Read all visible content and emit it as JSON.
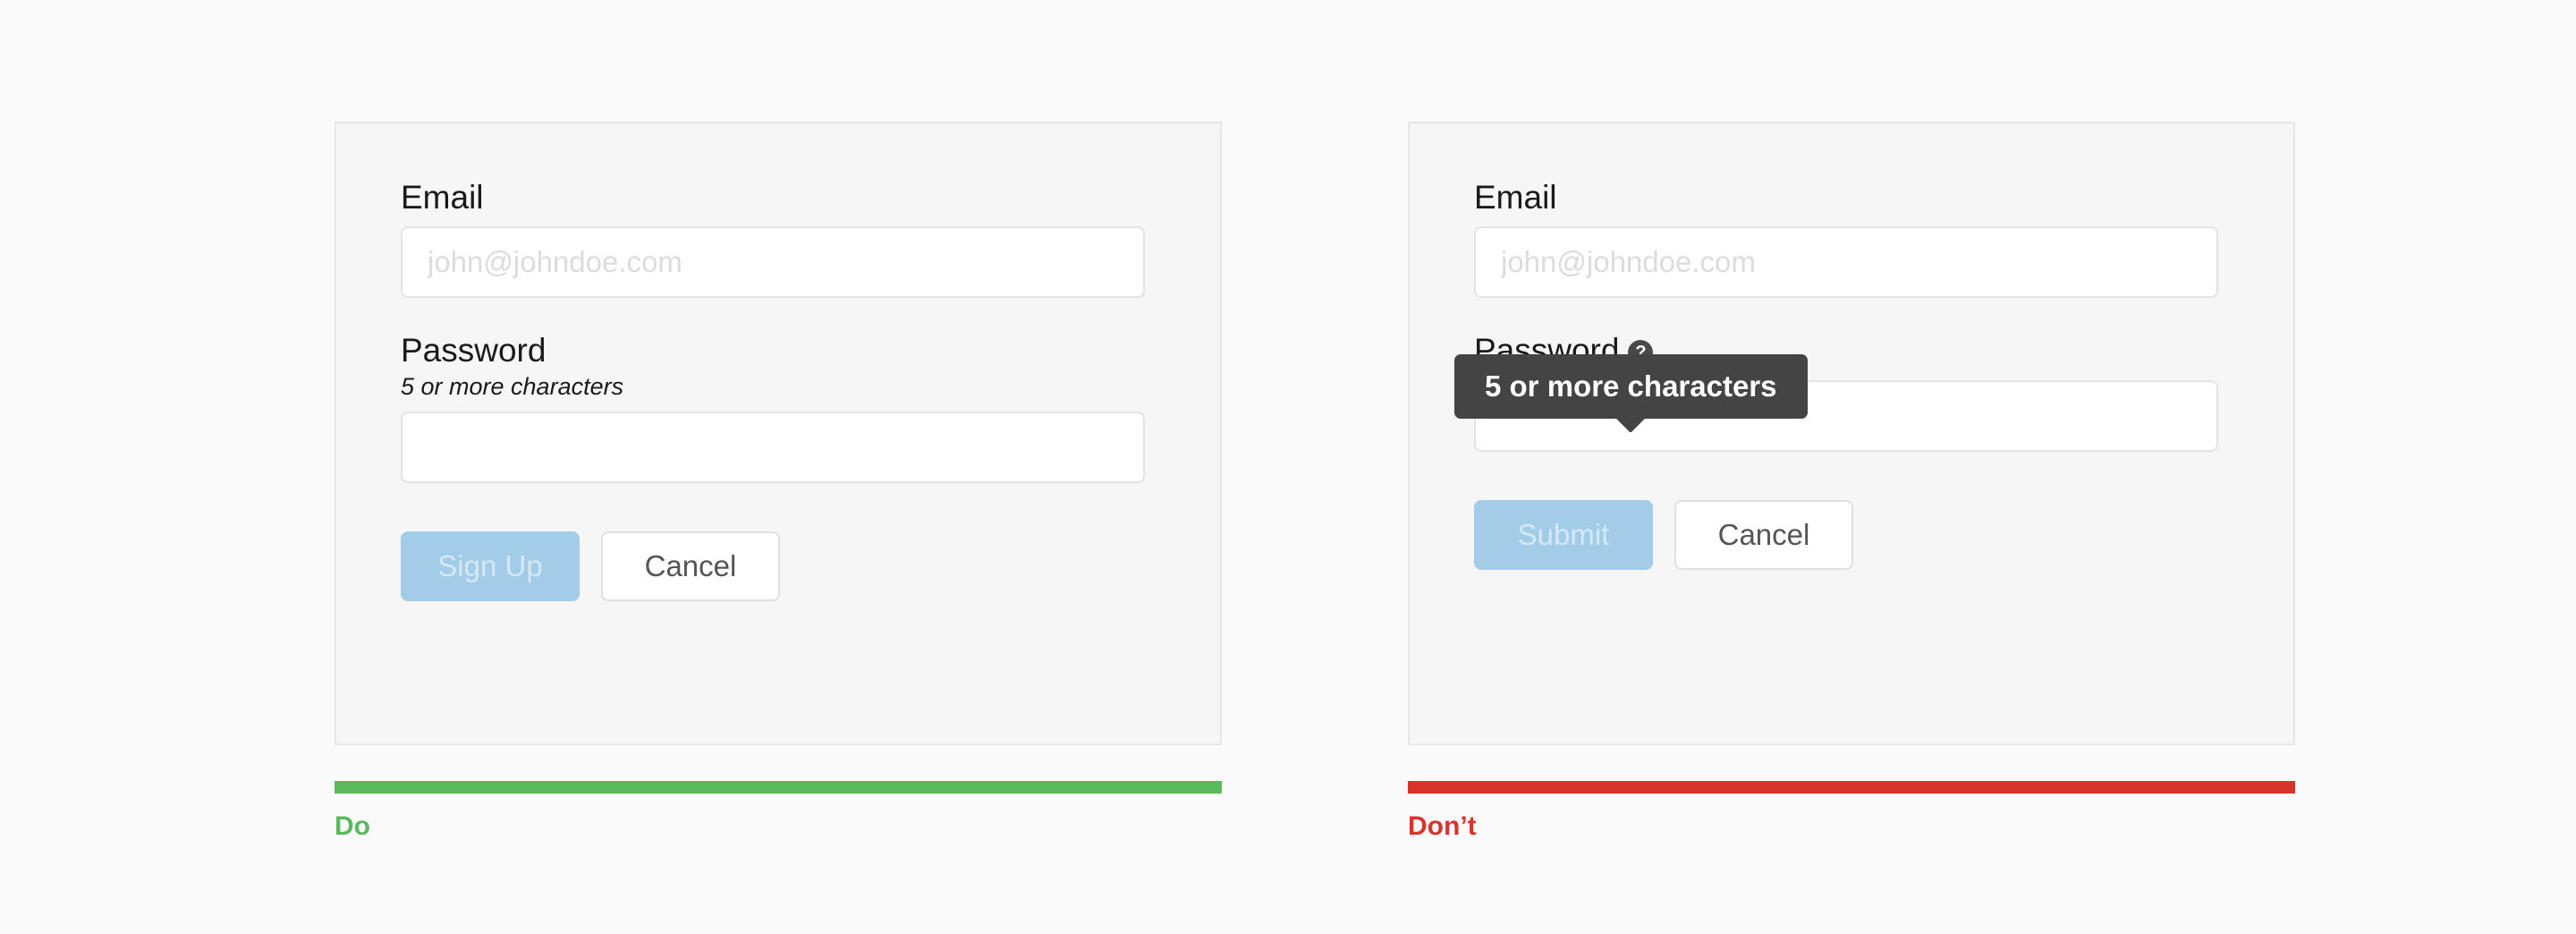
{
  "page": {
    "background_color": "#fafafa"
  },
  "examples": [
    {
      "variant": "do",
      "verdict_label": "Do",
      "verdict_color": "#5cb85c",
      "bar_color": "#5cb85c",
      "fields": {
        "email": {
          "label": "Email",
          "placeholder": "john@johndoe.com",
          "value": ""
        },
        "password": {
          "label": "Password",
          "helper_text": "5 or more characters",
          "placeholder": "",
          "value": ""
        }
      },
      "buttons": {
        "primary": "Sign Up",
        "secondary": "Cancel"
      },
      "tooltip": null
    },
    {
      "variant": "dont",
      "verdict_label": "Don’t",
      "verdict_color": "#d9342b",
      "bar_color": "#d9342b",
      "fields": {
        "email": {
          "label": "Email",
          "placeholder": "john@johndoe.com",
          "value": ""
        },
        "password": {
          "label": "Password",
          "helper_icon": "question-mark-help-icon",
          "helper_icon_glyph": "?",
          "placeholder": "",
          "value": ""
        }
      },
      "buttons": {
        "primary": "Submit",
        "secondary": "Cancel"
      },
      "tooltip": {
        "text": "5 or more characters",
        "background_color": "#444444",
        "text_color": "#ffffff"
      }
    }
  ]
}
